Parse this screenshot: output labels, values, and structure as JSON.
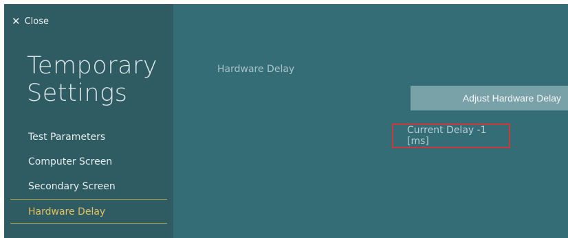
{
  "sidebar": {
    "close_label": "Close",
    "title_line1": "Temporary",
    "title_line2": "Settings",
    "items": [
      {
        "label": "Test Parameters"
      },
      {
        "label": "Computer Screen"
      },
      {
        "label": "Secondary Screen"
      },
      {
        "label": "Hardware Delay",
        "active": true
      }
    ]
  },
  "main": {
    "section_label": "Hardware Delay",
    "adjust_button_label": "Adjust Hardware Delay",
    "current_delay_text": "Current Delay -1 [ms]"
  },
  "colors": {
    "sidebar_bg": "#2f5b63",
    "main_bg": "#356d77",
    "active_accent": "#e4c15b",
    "button_bg": "#79a2a8",
    "highlight_border": "#c9383b"
  }
}
